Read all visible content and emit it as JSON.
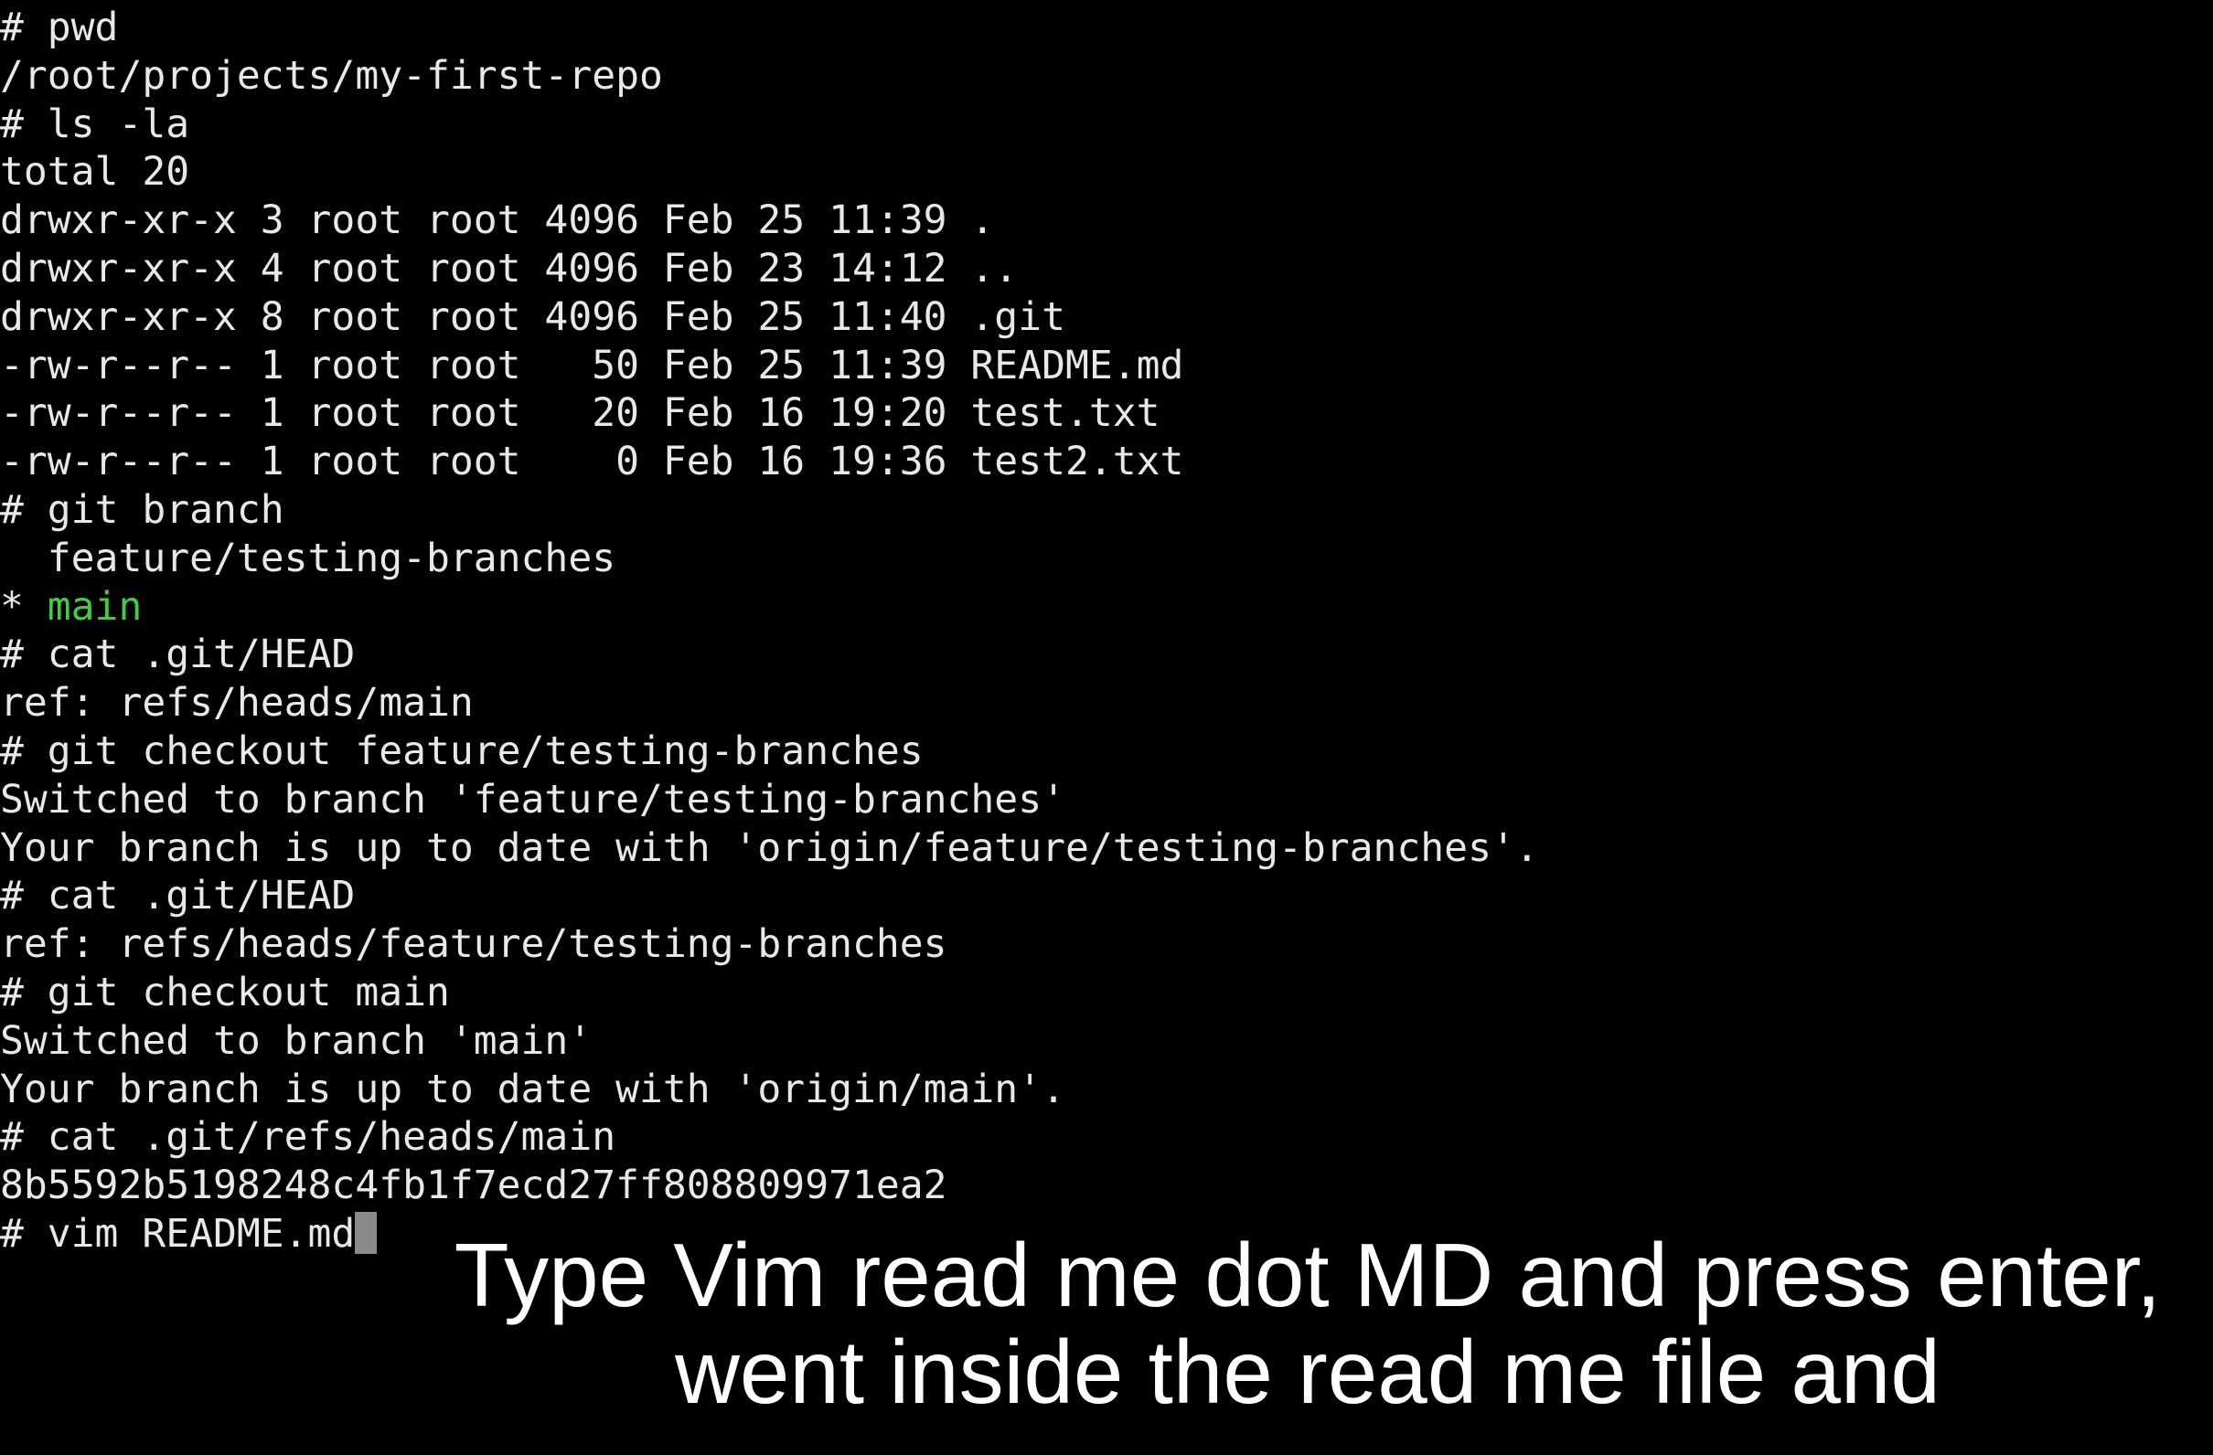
{
  "terminal": {
    "lines": [
      "# pwd",
      "/root/projects/my-first-repo",
      "# ls -la",
      "total 20",
      "drwxr-xr-x 3 root root 4096 Feb 25 11:39 .",
      "drwxr-xr-x 4 root root 4096 Feb 23 14:12 ..",
      "drwxr-xr-x 8 root root 4096 Feb 25 11:40 .git",
      "-rw-r--r-- 1 root root   50 Feb 25 11:39 README.md",
      "-rw-r--r-- 1 root root   20 Feb 16 19:20 test.txt",
      "-rw-r--r-- 1 root root    0 Feb 16 19:36 test2.txt",
      "# git branch",
      "  feature/testing-branches",
      "* ",
      "# cat .git/HEAD",
      "ref: refs/heads/main",
      "# git checkout feature/testing-branches",
      "Switched to branch 'feature/testing-branches'",
      "Your branch is up to date with 'origin/feature/testing-branches'.",
      "# cat .git/HEAD",
      "ref: refs/heads/feature/testing-branches",
      "# git checkout main",
      "Switched to branch 'main'",
      "Your branch is up to date with 'origin/main'.",
      "# cat .git/refs/heads/main",
      "8b5592b5198248c4fb1f7ecd27ff808809971ea2",
      "# vim README.md"
    ],
    "current_branch": "main",
    "colors": {
      "background": "#000000",
      "text": "#e8e8e8",
      "current_branch": "#3ecf3e",
      "cursor": "#8a8a8a"
    }
  },
  "caption": {
    "line1": "Type Vim read me dot MD and press enter,",
    "line2": "went inside the read me file and"
  }
}
